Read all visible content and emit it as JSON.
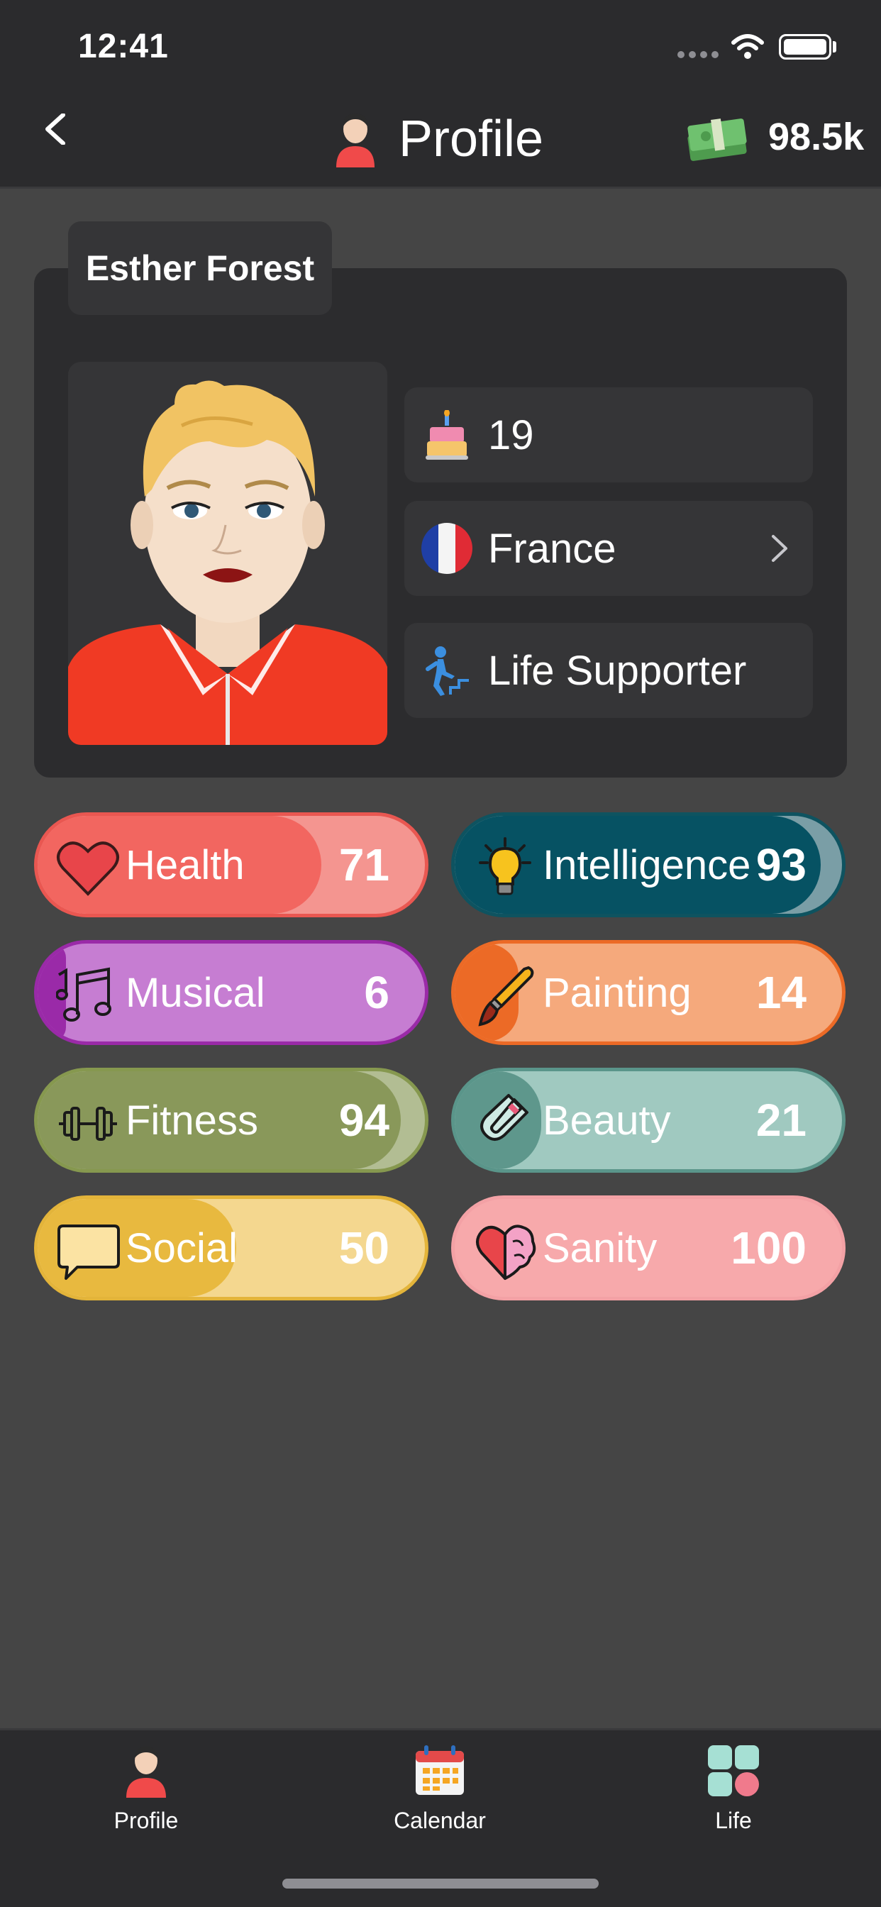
{
  "status_bar": {
    "time": "12:41"
  },
  "nav": {
    "title": "Profile",
    "money": "98.5k"
  },
  "profile": {
    "name": "Esther Forest",
    "age": "19",
    "country": "France",
    "occupation": "Life Supporter"
  },
  "stats": [
    {
      "label": "Health",
      "value": "71",
      "icon": "heart-icon"
    },
    {
      "label": "Intelligence",
      "value": "93",
      "icon": "lightbulb-icon"
    },
    {
      "label": "Musical",
      "value": "6",
      "icon": "music-notes-icon"
    },
    {
      "label": "Painting",
      "value": "14",
      "icon": "paintbrush-icon"
    },
    {
      "label": "Fitness",
      "value": "94",
      "icon": "dumbbell-icon"
    },
    {
      "label": "Beauty",
      "value": "21",
      "icon": "magnet-icon"
    },
    {
      "label": "Social",
      "value": "50",
      "icon": "speech-bubble-icon"
    },
    {
      "label": "Sanity",
      "value": "100",
      "icon": "heart-brain-icon"
    }
  ],
  "tabs": [
    {
      "label": "Profile"
    },
    {
      "label": "Calendar"
    },
    {
      "label": "Life"
    }
  ]
}
